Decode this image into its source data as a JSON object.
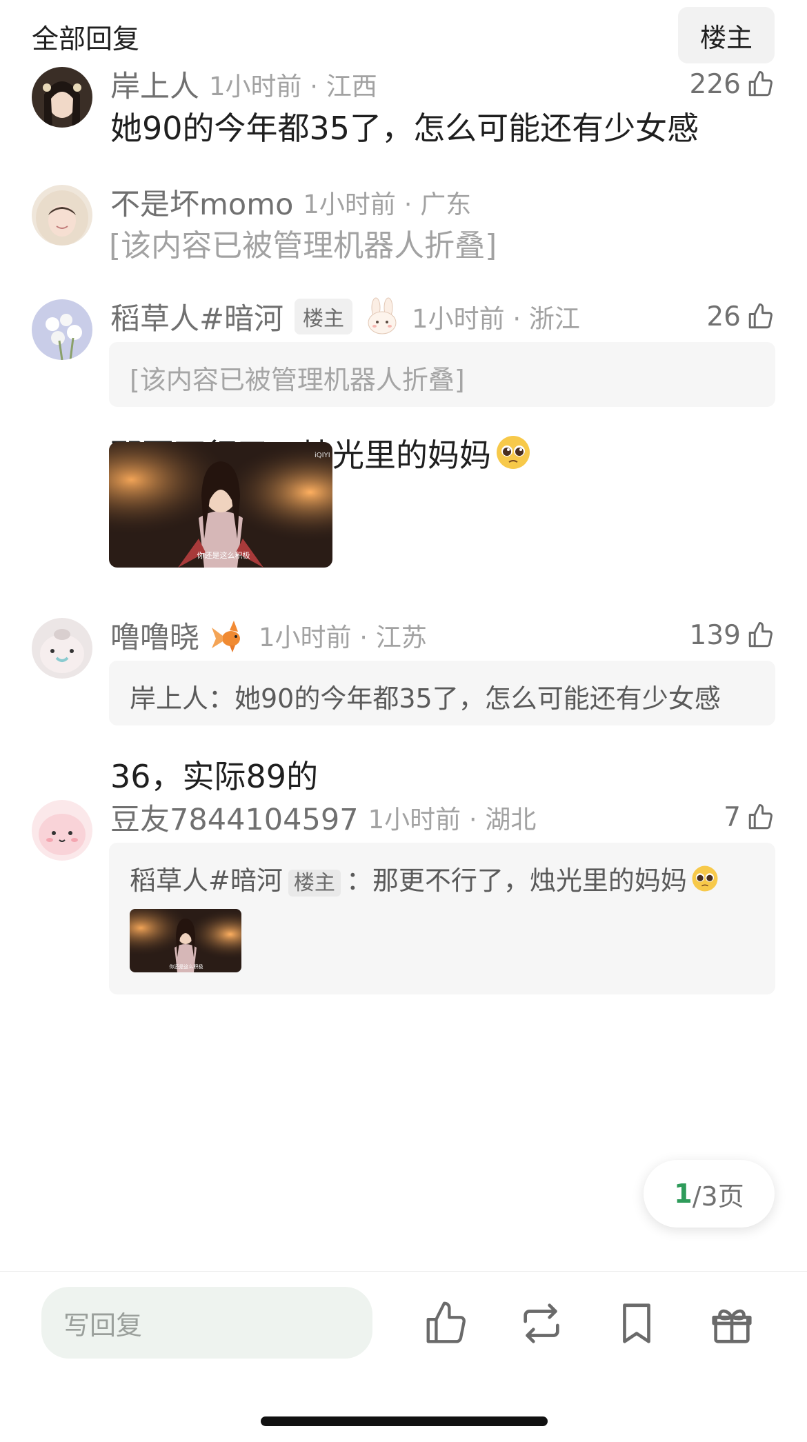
{
  "header": {
    "title": "全部回复",
    "op_filter_label": "楼主"
  },
  "comments": [
    {
      "username": "岸上人",
      "time_location": "1小时前 · 江西",
      "likes": "226",
      "text": "她90的今年都35了，怎么可能还有少女感"
    },
    {
      "username": "不是坏momo",
      "time_location": "1小时前 · 广东",
      "folded_text": "[该内容已被管理机器人折叠]"
    },
    {
      "username": "稻草人#暗河",
      "op_badge": "楼主",
      "time_location": "1小时前 · 浙江",
      "likes": "26",
      "quote_text": "[该内容已被管理机器人折叠]",
      "text": "那更不行了，烛光里的妈妈",
      "image": {
        "watermark": "iQIYI",
        "subtitle": "你还是这么积极"
      }
    },
    {
      "username": "噜噜晓",
      "time_location": "1小时前 · 江苏",
      "likes": "139",
      "quote_text": "岸上人：她90的今年都35了，怎么可能还有少女感",
      "text": "36，实际89的"
    },
    {
      "username": "豆友7844104597",
      "time_location": "1小时前 · 湖北",
      "likes": "7",
      "quote_author": "稻草人#暗河",
      "quote_badge": "楼主",
      "quote_sep": "：",
      "quote_text": "那更不行了，烛光里的妈妈",
      "quote_thumb_subtitle": "你还是这么积极"
    }
  ],
  "pagination": {
    "current": "1",
    "total": "/3页"
  },
  "bottom_bar": {
    "reply_placeholder": "写回复",
    "icons": [
      "thumbs-up-icon",
      "repost-icon",
      "bookmark-icon",
      "gift-icon"
    ]
  },
  "colors": {
    "accent_green": "#2e9b5a",
    "muted_text": "#a2a2a2",
    "username_gray": "#707070"
  }
}
